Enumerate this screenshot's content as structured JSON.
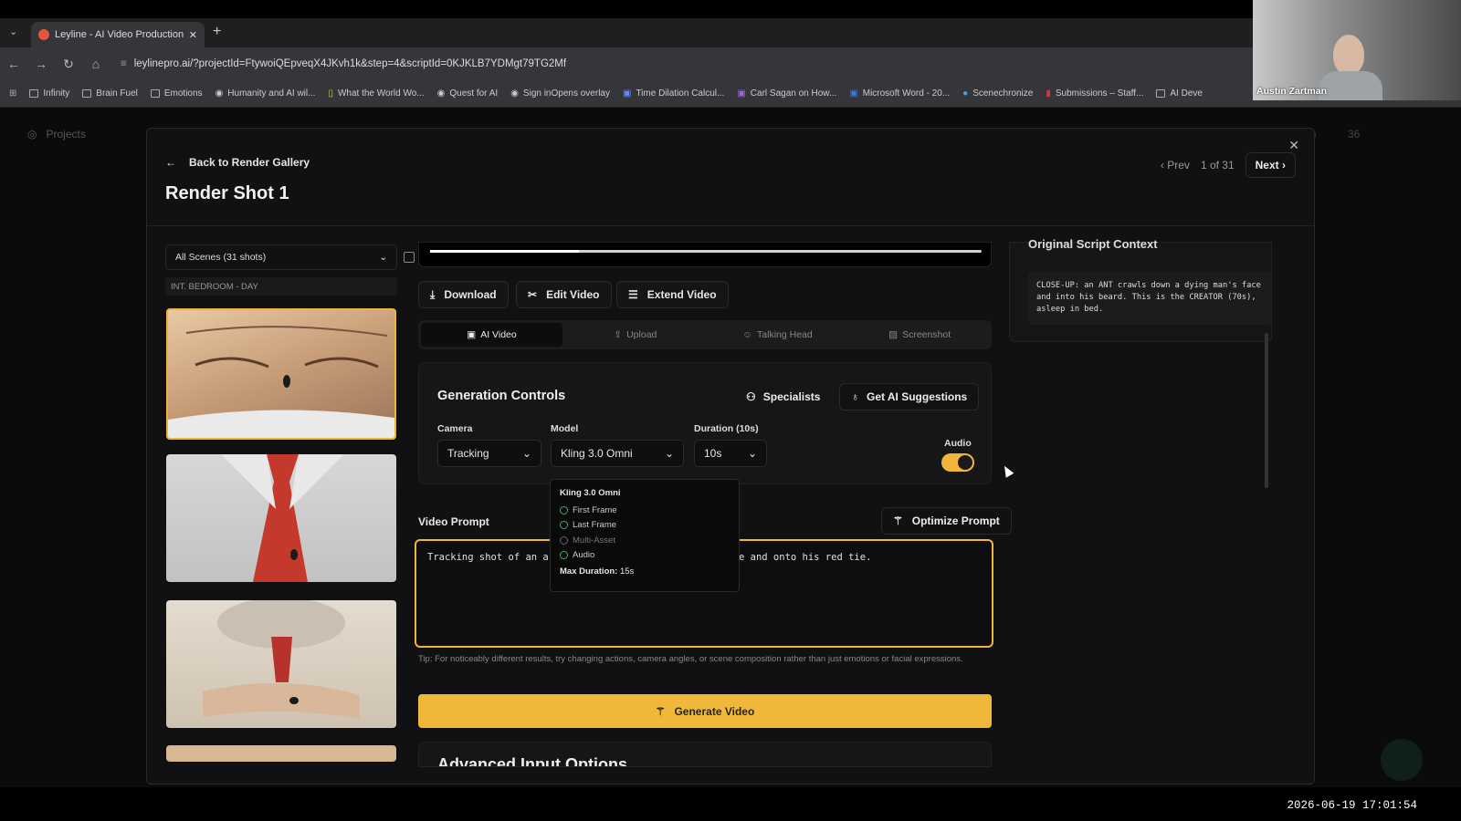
{
  "browser": {
    "tab_title": "Leyline - AI Video Production P",
    "url": "leylinepro.ai/?projectId=FtywoiQEpveqX4JKvh1k&step=4&scriptId=0KJKLB7YDMgt79TG2Mf",
    "bookmarks": [
      "Infinity",
      "Brain Fuel",
      "Emotions",
      "Humanity and AI wil...",
      "What the World Wo...",
      "Quest for AI",
      "Sign inOpens overlay",
      "Time Dilation Calcul...",
      "Carl Sagan on How...",
      "Microsoft Word - 20...",
      "Scenechronize",
      "Submissions – Staff...",
      "AI Deve"
    ]
  },
  "app_nav": {
    "projects": "Projects",
    "right_label": "eem",
    "count": "36"
  },
  "modal": {
    "back_label": "Back to Render Gallery",
    "title": "Render Shot 1",
    "prev": "Prev",
    "counter": "1 of 31",
    "next": "Next"
  },
  "left": {
    "scene_select": "All Scenes (31 shots)",
    "scene_header": "INT. BEDROOM - DAY"
  },
  "player": {
    "progress": 0.27
  },
  "actions": {
    "download": "Download",
    "edit": "Edit Video",
    "extend": "Extend Video"
  },
  "tabs": [
    "AI Video",
    "Upload",
    "Talking Head",
    "Screenshot"
  ],
  "generation": {
    "title": "Generation Controls",
    "specialists": "Specialists",
    "suggestions": "Get AI Suggestions",
    "camera_label": "Camera",
    "camera_value": "Tracking",
    "model_label": "Model",
    "model_value": "Kling 3.0 Omni",
    "duration_label": "Duration (10s)",
    "duration_value": "10s",
    "audio_label": "Audio",
    "audio_on": true
  },
  "model_popup": {
    "title": "Kling 3.0 Omni",
    "features": [
      {
        "label": "First Frame",
        "supported": true
      },
      {
        "label": "Last Frame",
        "supported": true
      },
      {
        "label": "Multi-Asset",
        "supported": false
      },
      {
        "label": "Audio",
        "supported": true
      }
    ],
    "max_duration_label": "Max Duration:",
    "max_duration_value": "15s"
  },
  "prompt": {
    "label": "Video Prompt",
    "optimize": "Optimize Prompt",
    "text_visible_start": "Tracking shot of an ar",
    "text_visible_end": "e and onto his red tie.",
    "tip": "Tip: For noticeably different results, try changing actions, camera angles, or scene composition rather than just emotions or facial expressions."
  },
  "generate_label": "Generate Video",
  "advanced_label": "Advanced Input Options",
  "script_context": {
    "title": "Original Script Context",
    "text": "CLOSE-UP: an ANT crawls down a dying man's face and into his beard. This is the CREATOR (70s), asleep in bed."
  },
  "overlay": {
    "webcam_name": "Austin Zartman",
    "timestamp": "2026-06-19 17:01:54"
  },
  "colors": {
    "accent": "#f2b53b",
    "background": "#111113"
  }
}
